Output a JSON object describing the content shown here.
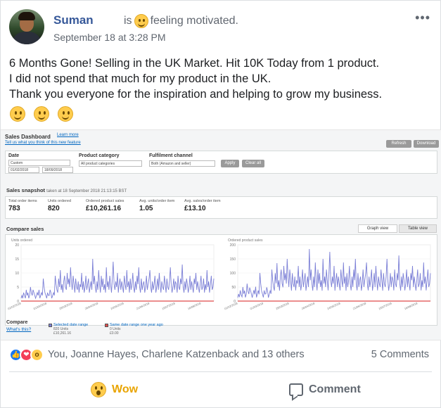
{
  "post": {
    "author": "Suman",
    "status_prefix": "is",
    "status_text": "feeling motivated.",
    "timestamp": "September 18 at 3:28 PM",
    "more_label": "•••",
    "body_lines": [
      "6 Months Gone! Selling in the UK Market. Hit 10K Today from 1 product.",
      "I did not spend that much for my product in the UK.",
      "Thank you everyone for the inspiration and helping to grow my business."
    ]
  },
  "dashboard": {
    "title": "Sales Dashboard",
    "learn_more": "Learn more",
    "feedback_link": "Tell us what you think of this new feature",
    "refresh": "Refresh",
    "download": "Download",
    "filters": {
      "date_label": "Date",
      "date_value": "Custom",
      "date_from": "01/02/2018",
      "date_to": "18/09/2018",
      "category_label": "Product category",
      "category_value": "All product categories",
      "fulfilment_label": "Fulfilment channel",
      "fulfilment_value": "Both (Amazon and seller)",
      "apply": "Apply",
      "clear": "Clear all"
    },
    "snapshot": {
      "title": "Sales snapshot",
      "taken": "taken at 18 September 2018 21:13:15 BST",
      "metrics": [
        {
          "label": "Total order items",
          "value": "783"
        },
        {
          "label": "Units ordered",
          "value": "820"
        },
        {
          "label": "Ordered product sales",
          "value": "£10,261.16"
        },
        {
          "label": "Avg. units/order item",
          "value": "1.05"
        },
        {
          "label": "Avg. sales/order item",
          "value": "£13.10"
        }
      ]
    },
    "compare": {
      "title": "Compare sales",
      "graph_view": "Graph view",
      "table_view": "Table view",
      "footer_title": "Compare",
      "whats_this": "What's this?",
      "legend_selected": "Selected date range",
      "legend_selected_sub1": "820 Units",
      "legend_selected_sub2": "£10,261.16",
      "legend_last_year": "Same date range one year ago",
      "legend_last_year_sub1": "0 Units",
      "legend_last_year_sub2": "£0.00"
    }
  },
  "chart_data": [
    {
      "type": "line",
      "ylabel": "Units ordered",
      "ylim": [
        0,
        20
      ],
      "yticks": [
        0,
        5,
        10,
        15,
        20
      ],
      "x_tick_labels": [
        "01/02/2018",
        "15/02/2018",
        "01/03/2018",
        "15/03/2018",
        "29/03/2018",
        "12/04/2018",
        "26/04/2018",
        "10/05/2018",
        "24/05/2018",
        "07/06/2018",
        "21/06/2018",
        "05/07/2018",
        "19/07/2018",
        "02/08/2018",
        "16/08/2018",
        "30/08/2018"
      ],
      "series": [
        {
          "color": "#7b7fd6",
          "values": [
            1,
            2,
            1,
            3,
            2,
            1,
            4,
            2,
            3,
            1,
            2,
            5,
            3,
            2,
            4,
            3,
            2,
            1,
            2,
            3,
            2,
            4,
            1,
            2,
            3,
            2,
            8,
            5,
            3,
            2,
            1,
            3,
            2,
            2,
            4,
            3,
            1,
            2,
            3,
            2,
            9,
            6,
            4,
            3,
            8,
            5,
            11,
            4,
            6,
            3,
            7,
            9,
            5,
            4,
            10,
            6,
            8,
            5,
            12,
            7,
            4,
            9,
            6,
            3,
            8,
            5,
            4,
            7,
            3,
            6,
            5,
            10,
            4,
            7,
            3,
            5,
            9,
            4,
            6,
            8,
            3,
            5,
            7,
            4,
            15,
            6,
            9,
            5,
            3,
            7,
            4,
            11,
            6,
            3,
            9,
            5,
            8,
            4,
            6,
            3,
            12,
            5,
            7,
            4,
            9,
            6,
            3,
            8,
            14,
            6,
            4,
            7,
            5,
            10,
            3,
            6,
            8,
            4,
            7,
            5,
            3,
            9,
            6,
            4,
            11,
            5,
            7,
            3,
            8,
            4,
            6,
            10,
            5,
            3,
            7,
            4,
            9,
            6,
            12,
            5,
            3,
            8,
            4,
            6,
            7,
            3,
            5,
            9,
            4,
            6,
            8,
            11,
            5,
            3,
            7,
            4,
            6,
            9,
            3,
            5,
            8,
            4,
            10,
            6,
            3,
            7,
            5,
            4,
            9,
            6,
            3,
            8,
            5,
            4,
            7,
            12,
            6,
            3,
            5,
            8,
            4,
            7,
            6,
            3,
            9,
            5,
            4,
            8,
            6,
            13,
            5,
            3,
            7,
            4,
            8,
            6,
            3,
            5,
            9,
            4,
            7,
            5,
            3,
            8,
            6,
            10,
            4,
            7,
            5,
            3,
            6,
            9,
            4,
            5,
            8,
            3,
            6,
            4,
            11,
            5,
            7,
            3,
            6,
            9,
            4,
            5,
            8
          ]
        },
        {
          "color": "#e04a4a",
          "values": [
            0
          ]
        }
      ]
    },
    {
      "type": "line",
      "ylabel": "Ordered product sales",
      "ylim": [
        0,
        200
      ],
      "yticks": [
        0,
        50,
        100,
        150,
        200
      ],
      "x_tick_labels": [
        "01/02/2018",
        "15/02/2018",
        "01/03/2018",
        "15/03/2018",
        "29/03/2018",
        "12/04/2018",
        "26/04/2018",
        "10/05/2018",
        "24/05/2018",
        "07/06/2018",
        "21/06/2018",
        "05/07/2018",
        "19/07/2018",
        "02/08/2018",
        "16/08/2018",
        "30/08/2018"
      ],
      "series": [
        {
          "color": "#7b7fd6",
          "values": [
            12,
            25,
            14,
            38,
            22,
            15,
            50,
            26,
            37,
            13,
            24,
            62,
            36,
            25,
            48,
            38,
            25,
            12,
            26,
            39,
            24,
            51,
            13,
            25,
            38,
            24,
            100,
            62,
            36,
            25,
            13,
            38,
            25,
            26,
            49,
            37,
            12,
            25,
            37,
            26,
            112,
            74,
            50,
            37,
            99,
            63,
            135,
            50,
            74,
            37,
            87,
            112,
            63,
            49,
            125,
            74,
            99,
            62,
            150,
            87,
            50,
            112,
            74,
            37,
            99,
            62,
            50,
            87,
            38,
            74,
            62,
            125,
            50,
            87,
            38,
            62,
            112,
            50,
            74,
            99,
            37,
            62,
            87,
            50,
            185,
            74,
            112,
            62,
            37,
            87,
            50,
            137,
            74,
            38,
            112,
            62,
            99,
            50,
            74,
            37,
            150,
            62,
            87,
            50,
            112,
            74,
            38,
            99,
            175,
            74,
            50,
            87,
            62,
            125,
            37,
            74,
            99,
            50,
            87,
            62,
            38,
            112,
            74,
            50,
            137,
            62,
            87,
            37,
            99,
            50,
            74,
            125,
            62,
            38,
            87,
            50,
            112,
            74,
            150,
            62,
            38,
            99,
            50,
            74,
            87,
            37,
            62,
            112,
            50,
            74,
            99,
            137,
            62,
            38,
            87,
            50,
            74,
            112,
            37,
            62,
            99,
            50,
            125,
            74,
            38,
            87,
            62,
            50,
            112,
            74,
            37,
            99,
            62,
            50,
            87,
            150,
            74,
            37,
            62,
            99,
            50,
            87,
            74,
            38,
            112,
            62,
            50,
            99,
            74,
            162,
            62,
            37,
            87,
            50,
            99,
            74,
            38,
            62,
            112,
            50,
            87,
            62,
            38,
            99,
            74,
            125,
            50,
            87,
            62,
            37,
            74,
            112,
            50,
            62,
            99,
            38,
            74,
            50,
            137,
            62,
            87,
            38,
            74,
            112,
            50,
            62,
            99
          ]
        },
        {
          "color": "#e04a4a",
          "values": [
            0
          ]
        }
      ]
    }
  ],
  "reactions": {
    "names": "You, Joanne Hayes, Charlene Katzenback and 13 others",
    "comments": "5 Comments",
    "icons": [
      "like-icon",
      "love-icon",
      "wow-icon"
    ]
  },
  "actions": {
    "wow": "Wow",
    "comment": "Comment",
    "wow_color": "#e9a400"
  }
}
